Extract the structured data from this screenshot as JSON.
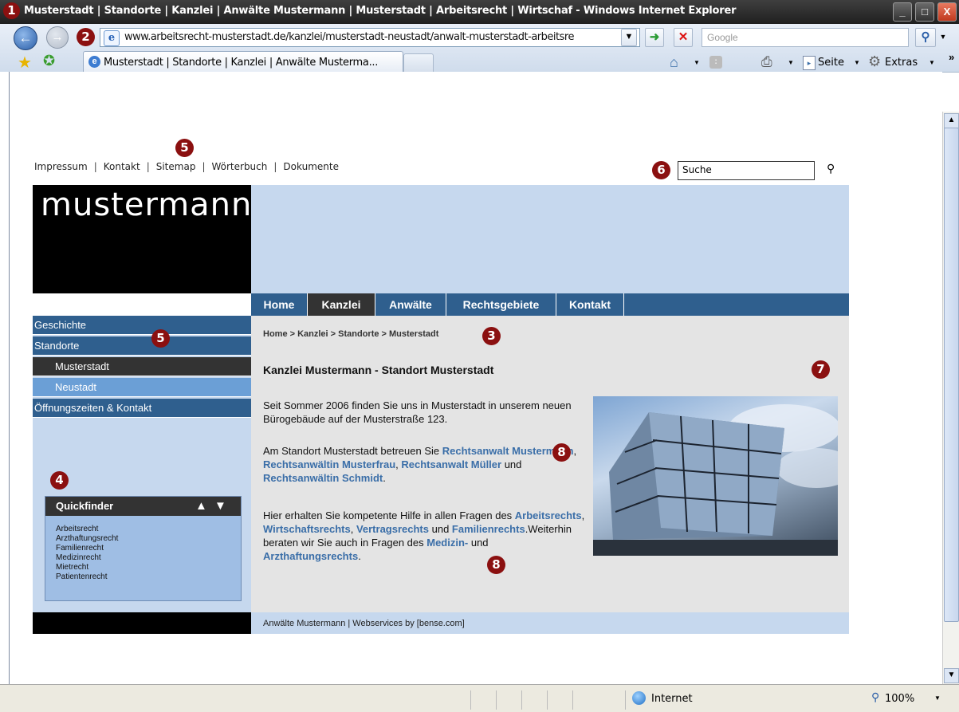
{
  "window": {
    "title": "Musterstadt | Standorte | Kanzlei | Anwälte Mustermann | Musterstadt | Arbeitsrecht | Wirtschaf - Windows Internet Explorer",
    "buttons": {
      "minimize": "_",
      "maximize": "□",
      "close": "X"
    }
  },
  "browser": {
    "url": "www.arbeitsrecht-musterstadt.de/kanzlei/musterstadt-neustadt/anwalt-musterstadt-arbeitsre",
    "search_placeholder": "Google",
    "tab_label": "Musterstadt | Standorte | Kanzlei | Anwälte Musterma...",
    "toolbar": {
      "page": "Seite",
      "tools": "Extras"
    },
    "status": {
      "zone": "Internet",
      "zoom": "100%"
    }
  },
  "markers": [
    "1",
    "2",
    "3",
    "4",
    "5",
    "5",
    "6",
    "7",
    "8",
    "8"
  ],
  "site": {
    "top_links": [
      "Impressum",
      "Kontakt",
      "Sitemap",
      "Wörterbuch",
      "Dokumente"
    ],
    "search_value": "Suche",
    "logo": "mustermann",
    "main_nav": [
      "Home",
      "Kanzlei",
      "Anwälte",
      "Rechtsgebiete",
      "Kontakt"
    ],
    "active_nav": "Kanzlei",
    "sidebar": [
      "Geschichte",
      "Standorte",
      "Musterstadt",
      "Neustadt",
      "Öffnungszeiten & Kontakt"
    ],
    "quickfinder": {
      "title": "Quickfinder",
      "items": [
        "Arbeitsrecht",
        "Arzthaftungsrecht",
        "Familienrecht",
        "Medizinrecht",
        "Mietrecht",
        "Patientenrecht"
      ]
    },
    "breadcrumb": "Home > Kanzlei > Standorte > Musterstadt",
    "page_title": "Kanzlei Mustermann - Standort Musterstadt",
    "p1": "Seit Sommer 2006 finden Sie uns in Musterstadt in unserem neuen Bürogebäude auf der Musterstraße 123.",
    "p2": {
      "intro": "Am Standort Musterstadt betreuen Sie ",
      "l1": "Rechtsanwalt Mustermann",
      "s1": ", ",
      "l2": "Rechtsanwältin Musterfrau",
      "s2": ", ",
      "l3": "Rechtsanwalt Müller",
      "s3": " und ",
      "l4": "Rechtsanwältin Schmidt",
      "end": "."
    },
    "p3": {
      "intro": "Hier erhalten Sie kompetente Hilfe in allen Fragen des ",
      "l1": "Arbeitsrechts",
      "s1": ", ",
      "l2": "Wirtschaftsrechts",
      "s2": ", ",
      "l3": "Vertragsrechts",
      "s3": " und ",
      "l4": "Familienrechts",
      "s4": ".Weiterhin beraten wir Sie auch in Fragen des ",
      "l5": "Medizin-",
      "s5": " und ",
      "l6": "Arzthaftungsrechts",
      "end": "."
    },
    "footer": "Anwälte Mustermann | Webservices by [bense.com]"
  }
}
